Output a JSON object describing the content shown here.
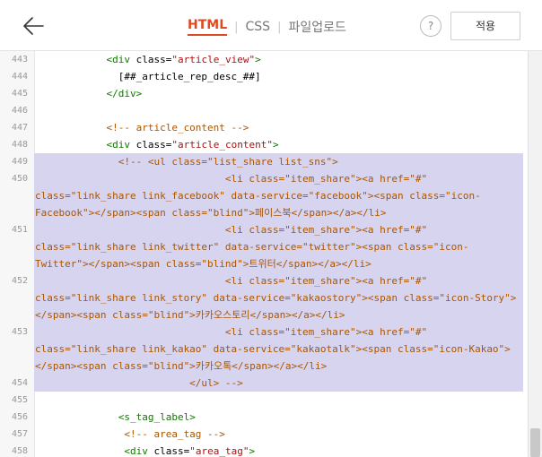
{
  "header": {
    "tabs": [
      {
        "label": "HTML",
        "active": true
      },
      {
        "label": "CSS",
        "active": false
      },
      {
        "label": "파일업로드",
        "active": false
      }
    ],
    "help_label": "?",
    "apply_label": "적용"
  },
  "editor": {
    "lines": [
      {
        "num": "443",
        "text": "            <div class=\"article_view\">"
      },
      {
        "num": "444",
        "text": "              [##_article_rep_desc_##]"
      },
      {
        "num": "445",
        "text": "            </div>"
      },
      {
        "num": "446",
        "text": ""
      },
      {
        "num": "447",
        "text": "            <!-- article_content -->"
      },
      {
        "num": "448",
        "text": "            <div class=\"article_content\">"
      },
      {
        "num": "449",
        "text": "              <!-- <ul class=\"list_share list_sns\">"
      },
      {
        "num": "450",
        "text": "                                <li class=\"item_share\"><a href=\"#\""
      },
      {
        "num": "",
        "text": "class=\"link_share link_facebook\" data-service=\"facebook\"><span class=\"icon-"
      },
      {
        "num": "",
        "text": "Facebook\"></span><span class=\"blind\">페이스북</span></a></li>"
      },
      {
        "num": "451",
        "text": "                                <li class=\"item_share\"><a href=\"#\""
      },
      {
        "num": "",
        "text": "class=\"link_share link_twitter\" data-service=\"twitter\"><span class=\"icon-"
      },
      {
        "num": "",
        "text": "Twitter\"></span><span class=\"blind\">트위터</span></a></li>"
      },
      {
        "num": "452",
        "text": "                                <li class=\"item_share\"><a href=\"#\""
      },
      {
        "num": "",
        "text": "class=\"link_share link_story\" data-service=\"kakaostory\"><span class=\"icon-Story\">"
      },
      {
        "num": "",
        "text": "</span><span class=\"blind\">카카오스토리</span></a></li>"
      },
      {
        "num": "453",
        "text": "                                <li class=\"item_share\"><a href=\"#\""
      },
      {
        "num": "",
        "text": "class=\"link_share link_kakao\" data-service=\"kakaotalk\"><span class=\"icon-Kakao\">"
      },
      {
        "num": "",
        "text": "</span><span class=\"blind\">카카오톡</span></a></li>"
      },
      {
        "num": "454",
        "text": "                          </ul> -->"
      },
      {
        "num": "455",
        "text": ""
      },
      {
        "num": "456",
        "text": "              <s_tag_label>"
      },
      {
        "num": "457",
        "text": "               <!-- area_tag -->"
      },
      {
        "num": "458",
        "text": "               <div class=\"area_tag\">"
      }
    ]
  }
}
